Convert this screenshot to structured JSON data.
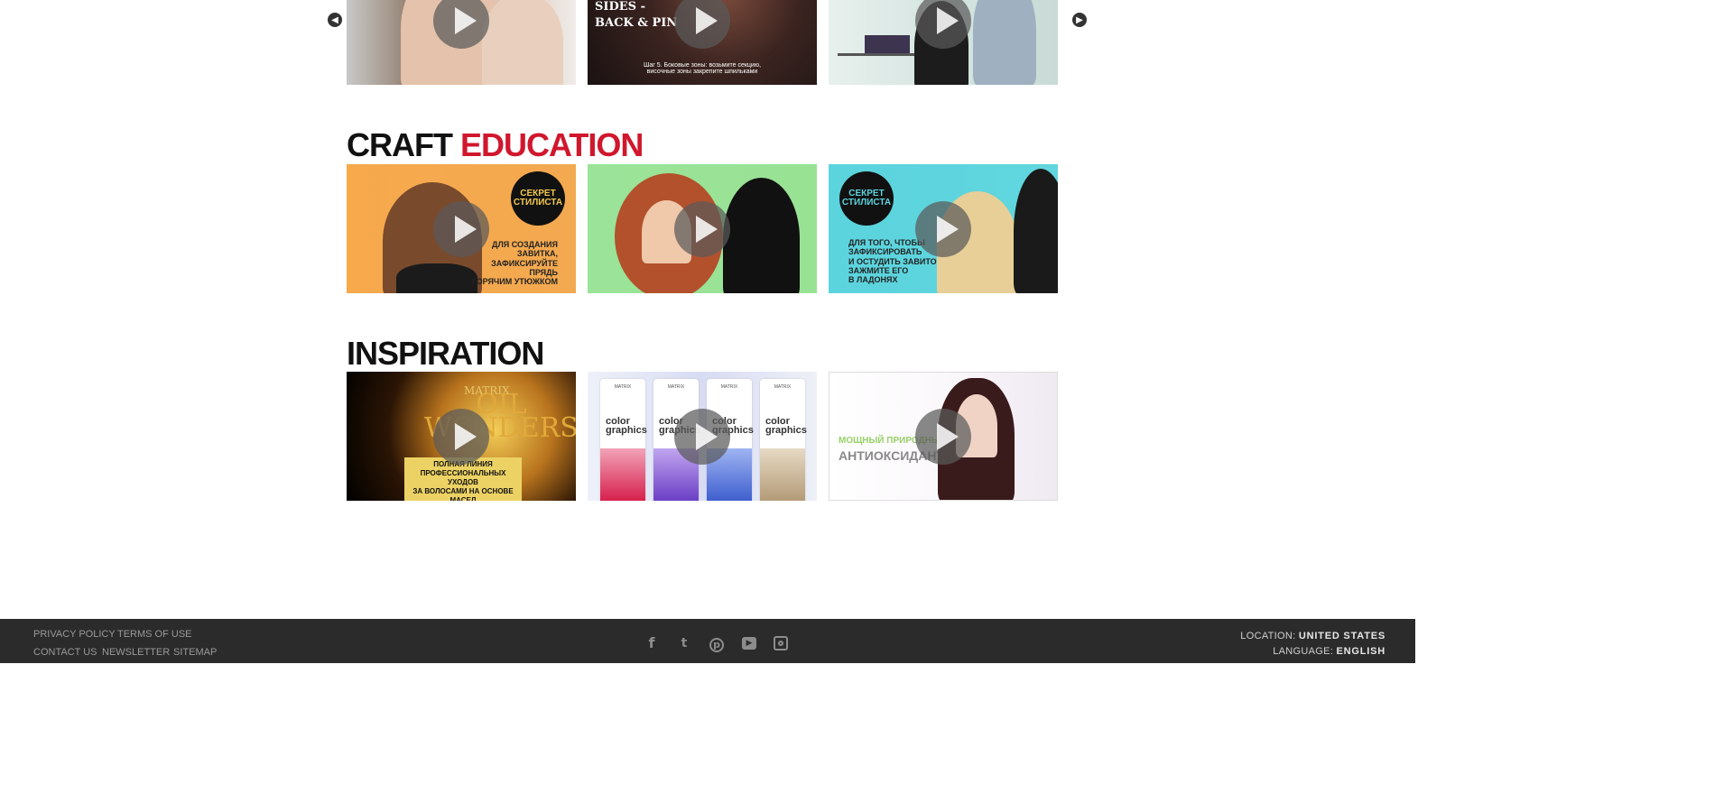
{
  "carousel": {
    "prev_icon": "chevron-left-icon",
    "next_icon": "chevron-right-icon"
  },
  "top_row": {
    "video2_title": "SIDES -\nBACK & PIN",
    "video2_caption": "Шаг 5. Боковые зоны: возьмите секцию,\nвисочные зоны закрепите шпильками"
  },
  "craft": {
    "title_part1": "CRAFT",
    "title_part2": "EDUCATION",
    "accent_color": "#d0172d",
    "videos": [
      {
        "badge": "СЕКРЕТ\nСТИЛИСТА",
        "text": "ДЛЯ СОЗДАНИЯ\nЗАВИТКА,\nЗАФИКСИРУЙТЕ\nПРЯДЬ\nГОРЯЧИМ УТЮЖКОМ"
      },
      {},
      {
        "badge": "СЕКРЕТ\nСТИЛИСТА",
        "text": "ДЛЯ ТОГО, ЧТОБЫ\nЗАФИКСИРОВАТЬ\nИ ОСТУДИТЬ ЗАВИТОК\nЗАЖМИТЕ ЕГО\nВ ЛАДОНЯХ"
      }
    ]
  },
  "inspiration": {
    "title": "INSPIRATION",
    "videos": [
      {
        "brand": "MATRIX",
        "product": "OIL\nWONDERS",
        "text": "ПОЛНАЯ ЛИНИЯ\nПРОФЕССИОНАЛЬНЫХ УХОДОВ\nЗА ВОЛОСАМИ НА ОСНОВЕ МАСЕЛ"
      },
      {
        "tube_brand": "MATRIX",
        "tube_product": "color\ngraphics"
      },
      {
        "line1": "МОЩНЫЙ ПРИРОДНЫЙ",
        "line2": "АНТИОКСИДАНТ"
      }
    ]
  },
  "footer": {
    "links_row1": [
      "PRIVACY POLICY",
      "TERMS OF USE"
    ],
    "links_row2": [
      "CONTACT US",
      "NEWSLETTER",
      "SITEMAP"
    ],
    "social_icons": [
      "facebook-icon",
      "twitter-icon",
      "pinterest-icon",
      "youtube-icon",
      "instagram-icon"
    ],
    "location_label": "LOCATION:",
    "location_value": "UNITED STATES",
    "language_label": "LANGUAGE:",
    "language_value": "ENGLISH"
  }
}
